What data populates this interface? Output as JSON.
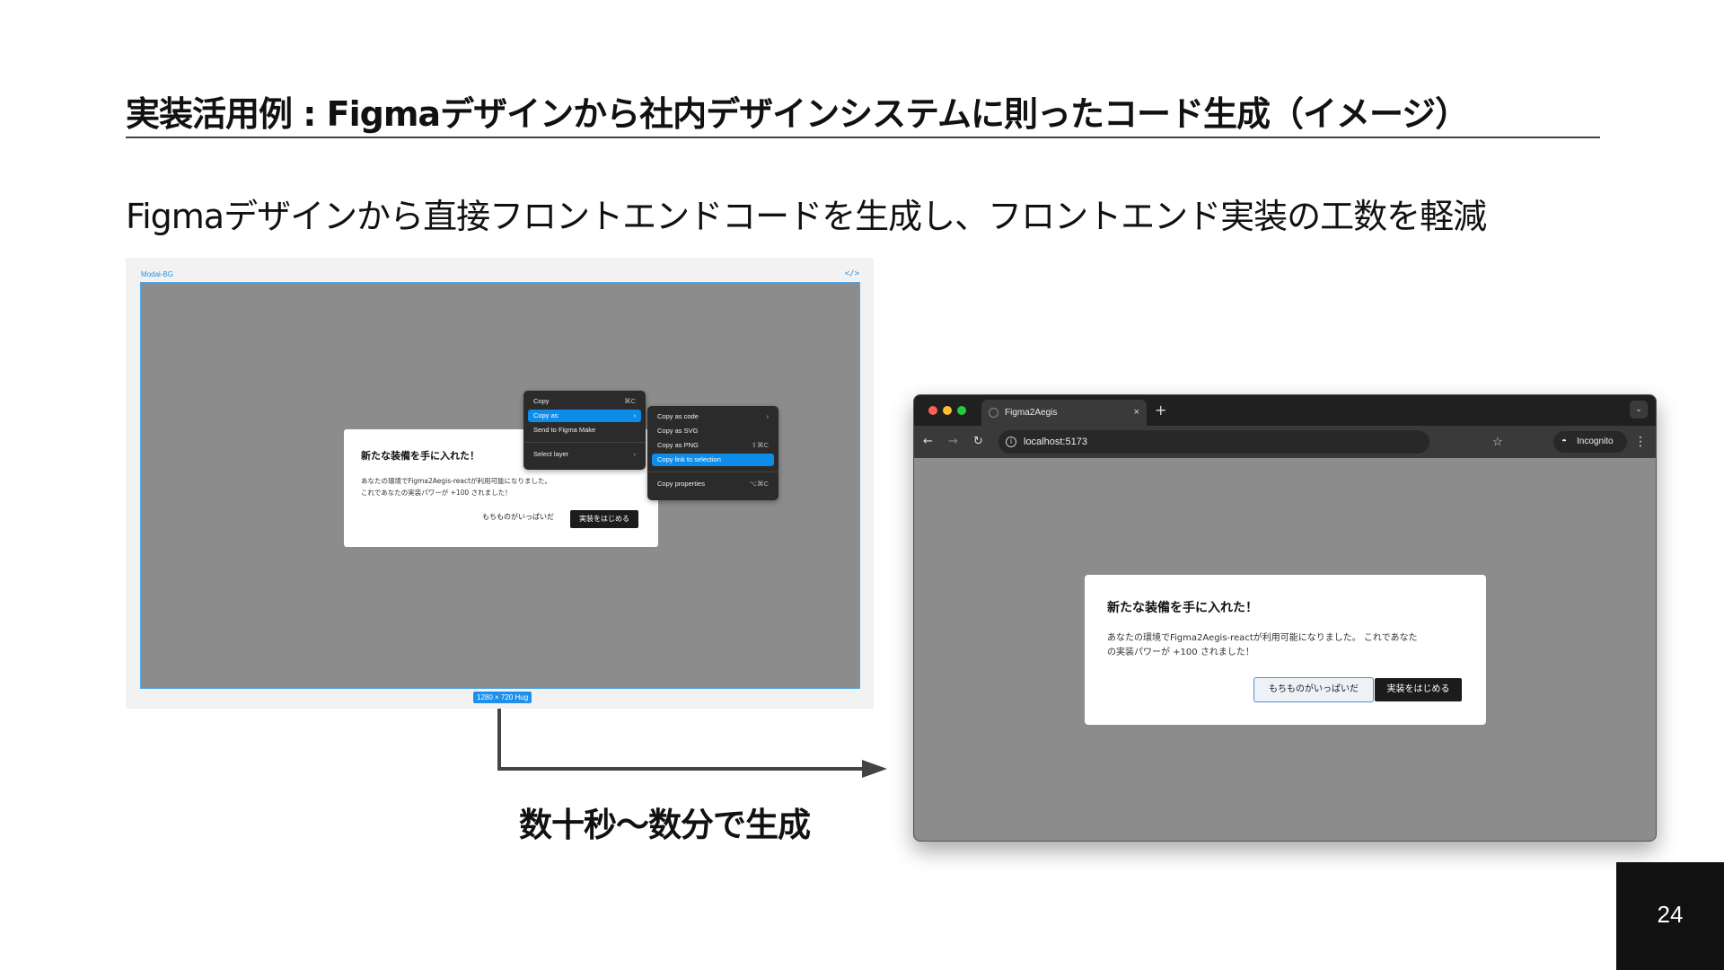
{
  "slide": {
    "title": "実装活用例 : Figmaデザインから社内デザインシステムに則ったコード生成（イメージ）",
    "subtitle": "Figmaデザインから直接フロントエンドコードを生成し、フロントエンド実装の工数を軽減",
    "caption": "数十秒〜数分で生成",
    "page_number": "24"
  },
  "figma": {
    "frame_label": "Modal-BG",
    "code_icon": "</>",
    "size_badge": "1280 × 720 Hug",
    "modal": {
      "title": "新たな装備を手に入れた！",
      "body_line1": "あなたの環境でFigma2Aegis-reactが利用可能になりました。",
      "body_line2": "これであなたの実装パワーが +100 されました！",
      "secondary_button": "もちものがいっぱいだ",
      "primary_button": "実装をはじめる"
    },
    "context_menu": [
      {
        "label": "Copy",
        "shortcut": "⌘C"
      },
      {
        "label": "Copy as",
        "shortcut": "›"
      },
      {
        "label": "Send to Figma Make",
        "shortcut": ""
      },
      {
        "label": "Select layer",
        "shortcut": "›"
      }
    ],
    "submenu": [
      {
        "label": "Copy as code",
        "shortcut": "›"
      },
      {
        "label": "Copy as SVG",
        "shortcut": ""
      },
      {
        "label": "Copy as PNG",
        "shortcut": "⇧⌘C"
      },
      {
        "label": "Copy link to selection",
        "shortcut": ""
      },
      {
        "label": "Copy properties",
        "shortcut": "⌥⌘C"
      }
    ]
  },
  "browser": {
    "tab_title": "Figma2Aegis",
    "tab_close": "×",
    "new_tab": "+",
    "tab_menu": "⌄",
    "url": "localhost:5173",
    "incognito_label": "Incognito",
    "modal": {
      "title": "新たな装備を手に入れた！",
      "body_line1": "あなたの環境でFigma2Aegis-reactが利用可能になりました。 これであなた",
      "body_line2": "の実装パワーが +100 されました！",
      "secondary_button": "もちものがいっぱいだ",
      "primary_button": "実装をはじめる"
    }
  },
  "colors": {
    "figma_selection": "#0d8ce9",
    "frame_bg": "#8c8c8c",
    "accent_blue": "#4e8fd6"
  }
}
